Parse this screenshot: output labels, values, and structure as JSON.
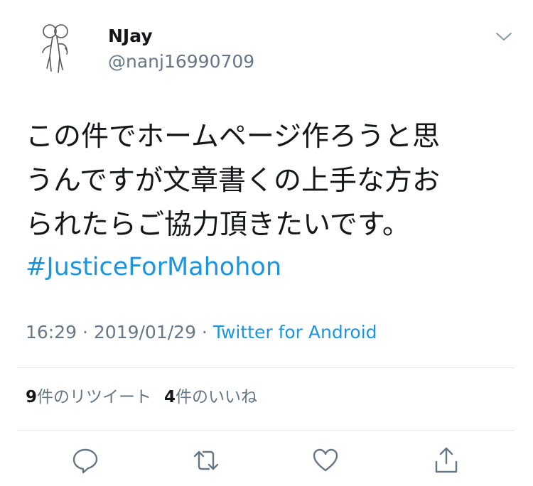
{
  "user": {
    "display_name": "NJay",
    "handle": "@nanj16990709"
  },
  "tweet": {
    "lines": [
      "この件でホームページ作ろうと思",
      "うんですが文章書くの上手な方お",
      "られたらご協力頂きたいです。"
    ],
    "hashtag": "#JusticeForMahohon"
  },
  "meta": {
    "time": "16:29",
    "separator1": " · ",
    "date": "2019/01/29",
    "separator2": " · ",
    "source": "Twitter for Android"
  },
  "stats": {
    "retweet_count": "9",
    "retweet_label": "件のリツイート",
    "like_count": "4",
    "like_label": "件のいいね"
  },
  "icons": {
    "avatar": "stick-figure-avatar",
    "caret": "chevron-down-icon",
    "reply": "reply-icon",
    "retweet": "retweet-icon",
    "like": "heart-icon",
    "share": "share-icon"
  },
  "colors": {
    "text": "#14171a",
    "secondary": "#657786",
    "link": "#1b95e0",
    "divider": "#e1e8ed"
  }
}
